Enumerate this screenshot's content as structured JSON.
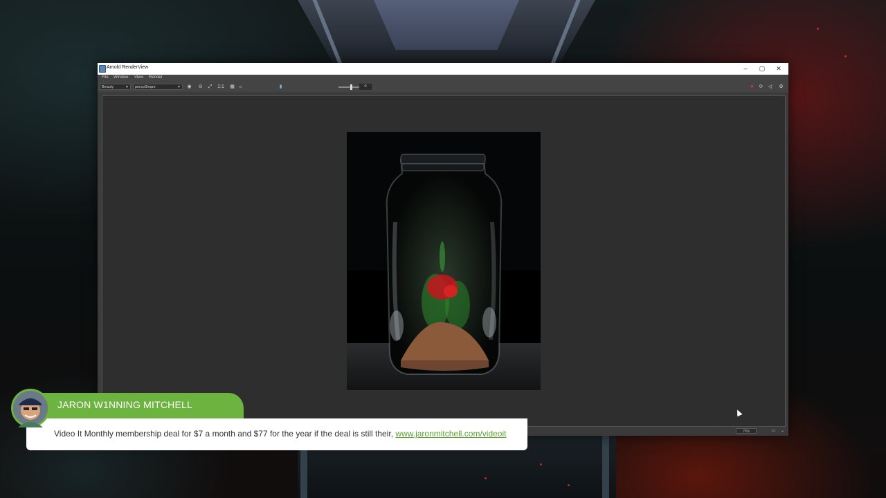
{
  "window": {
    "title": "Arnold RenderView",
    "controls": {
      "minimize": "–",
      "restore": "▢",
      "close": "✕"
    }
  },
  "menu": [
    "File",
    "Window",
    "View",
    "Render"
  ],
  "toolbar": {
    "aov_select": "Beauty",
    "camera_select": "perspShape",
    "ratio_label": "1:1",
    "exposure_value": "0",
    "icons": [
      "display-icon",
      "region-icon",
      "settings-icon",
      "stop-icon",
      "refresh-icon",
      "sound-icon",
      "gear-icon"
    ]
  },
  "status": {
    "zoom": "75%"
  },
  "render_colors": {
    "glass": "#b9c3c9",
    "sand": "#8a5a3a",
    "flower": "#c4161c",
    "leaves": "#2c8a2c"
  },
  "lower_third": {
    "name": "JARON W1NNING MITCHELL",
    "message": "Video It Monthly membership deal for $7 a month and $77 for the year if the deal is still their,",
    "link": "www.jaronmitchell.com/videoit",
    "accent": "#6db33f"
  }
}
